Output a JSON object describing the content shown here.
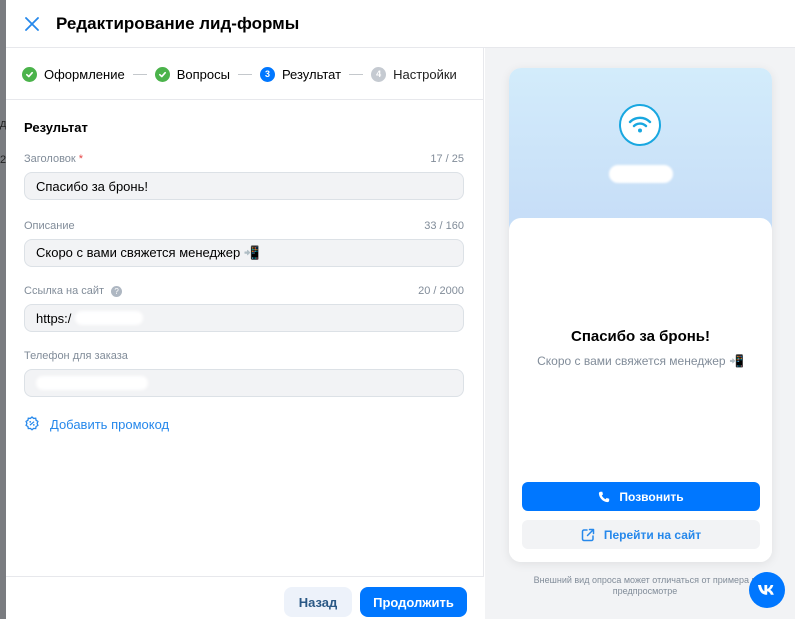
{
  "backdrop": {
    "glyph_1": "д",
    "glyph_2": "2"
  },
  "header": {
    "title": "Редактирование лид-формы",
    "close_icon": "close-icon"
  },
  "stepper": {
    "steps": [
      {
        "label": "Оформление",
        "state": "done",
        "marker": ""
      },
      {
        "label": "Вопросы",
        "state": "done",
        "marker": ""
      },
      {
        "label": "Результат",
        "state": "current",
        "marker": "3"
      },
      {
        "label": "Настройки",
        "state": "future",
        "marker": "4"
      }
    ]
  },
  "form": {
    "section_title": "Результат",
    "title_field": {
      "label": "Заголовок",
      "required_mark": "*",
      "counter": "17 / 25",
      "value": "Спасибо за бронь!"
    },
    "description_field": {
      "label": "Описание",
      "counter": "33 / 160",
      "value": "Скоро с вами свяжется менеджер 📲"
    },
    "link_field": {
      "label": "Ссылка на сайт",
      "help_mark": "?",
      "counter": "20 / 2000",
      "value": "https:/"
    },
    "phone_field": {
      "label": "Телефон для заказа",
      "value": ""
    },
    "promo_label": "Добавить промокод"
  },
  "footer": {
    "back_label": "Назад",
    "continue_label": "Продолжить"
  },
  "preview": {
    "title": "Спасибо за бронь!",
    "description": "Скоро с вами свяжется менеджер 📲",
    "call_label": "Позвонить",
    "site_label": "Перейти на сайт",
    "note": "Внешний вид опроса может отличаться от примера в предпросмотре"
  },
  "colors": {
    "accent": "#0077ff",
    "success": "#4bb34b",
    "link": "#2688eb",
    "required": "#e64646"
  }
}
